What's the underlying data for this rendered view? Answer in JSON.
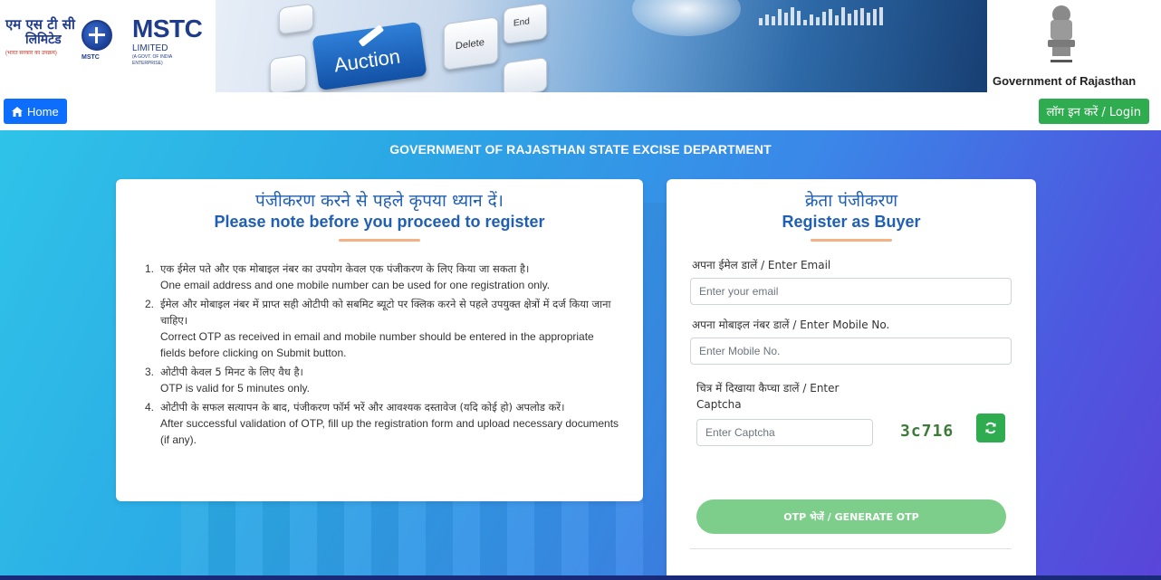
{
  "header": {
    "logo_hindi_line1": "एम एस टी सी",
    "logo_hindi_line2": "लिमिटेड",
    "logo_hindi_line3": "(भारत सरकार का उपक्रम)",
    "logo_globe_label": "MSTC",
    "logo_brand": "MSTC",
    "logo_limited": "LIMITED",
    "logo_tagline": "(A GOVT. OF INDIA ENTERPRISE)",
    "banner_key_auction": "Auction",
    "banner_key_delete": "Delete",
    "banner_key_end": "End",
    "gov_title": "Government of Rajasthan"
  },
  "nav": {
    "home_label": "Home",
    "login_label": "लॉग इन करें / Login"
  },
  "main": {
    "title": "GOVERNMENT OF RAJASTHAN STATE EXCISE DEPARTMENT"
  },
  "notes_card": {
    "title_hi": "पंजीकरण करने से पहले कृपया ध्यान दें।",
    "title_en": "Please note before you proceed to register",
    "items": [
      {
        "num": "1.",
        "hi": "एक ईमेल पते और एक मोबाइल नंबर का उपयोग केवल एक पंजीकरण के लिए किया जा सकता है।",
        "en": "One email address and one mobile number can be used for one registration only."
      },
      {
        "num": "2.",
        "hi": "ईमेल और मोबाइल नंबर में प्राप्त सही ओटीपी को सबमिट ब्यूटो पर क्लिक करने से पहले उपयुक्त क्षेत्रों में दर्ज किया जाना चाहिए।",
        "en": "Correct OTP as received in email and mobile number should be entered in the appropriate fields before clicking on Submit button."
      },
      {
        "num": "3.",
        "hi": "ओटीपी केवल 5 मिनट के लिए वैध है।",
        "en": "OTP is valid for 5 minutes only."
      },
      {
        "num": "4.",
        "hi": "ओटीपी के सफल सत्यापन के बाद, पंजीकरण फॉर्म भरें और आवश्यक दस्तावेज (यदि कोई हो) अपलोड करें।",
        "en": "After successful validation of OTP, fill up the registration form and upload necessary documents (if any)."
      }
    ]
  },
  "register_card": {
    "title_hi": "क्रेता पंजीकरण",
    "title_en": "Register as Buyer",
    "email_label": "अपना ईमेल डालें / Enter Email",
    "email_placeholder": "Enter your email",
    "mobile_label": "अपना मोबाइल नंबर डालें / Enter Mobile No.",
    "mobile_placeholder": "Enter Mobile No.",
    "captcha_label": "चित्र में दिखाया कैप्चा डालें / Enter Captcha",
    "captcha_placeholder": "Enter Captcha",
    "captcha_value": "3c716",
    "otp_button": "OTP भेजें / GENERATE OTP"
  },
  "colors": {
    "primary_blue": "#0d6efd",
    "success_green": "#2eac4f",
    "otp_button_green": "#7dce8a",
    "heading_blue": "#1f5fb4",
    "accent_underline": "#f4b183"
  },
  "icons": {
    "home": "home-icon",
    "refresh": "refresh-icon",
    "emblem": "ashoka-emblem-icon"
  }
}
